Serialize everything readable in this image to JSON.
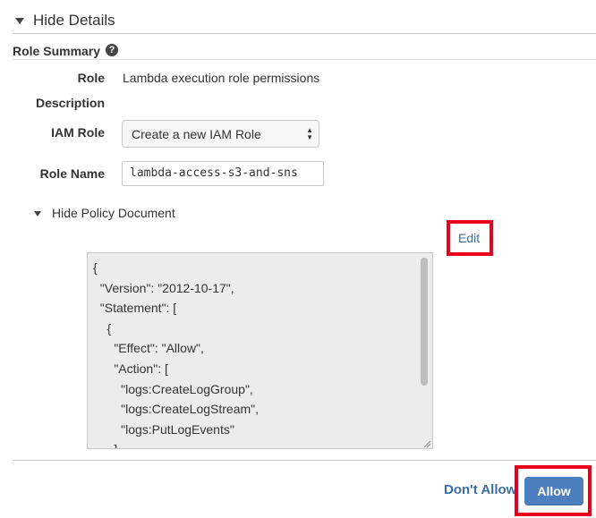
{
  "header": {
    "toggle_label": "Hide Details"
  },
  "role_summary": {
    "title": "Role Summary",
    "help_icon_glyph": "?",
    "fields": {
      "role_label": "Role",
      "role_value": "Lambda execution role permissions",
      "description_label": "Description",
      "iam_role_label": "IAM Role",
      "iam_role_selected": "Create a new IAM Role",
      "role_name_label": "Role Name",
      "role_name_value": "lambda-access-s3-and-sns"
    }
  },
  "policy": {
    "toggle_label": "Hide Policy Document",
    "edit_label": "Edit",
    "lines": [
      "{",
      "  \"Version\": \"2012-10-17\",",
      "  \"Statement\": [",
      "    {",
      "      \"Effect\": \"Allow\",",
      "      \"Action\": [",
      "        \"logs:CreateLogGroup\",",
      "        \"logs:CreateLogStream\",",
      "        \"logs:PutLogEvents\"",
      "      ],"
    ]
  },
  "footer": {
    "dont_allow_label": "Don't Allow",
    "allow_label": "Allow"
  },
  "colors": {
    "highlight": "#e8001c",
    "link": "#3a6fa4",
    "primary_button": "#4d7ec0"
  }
}
